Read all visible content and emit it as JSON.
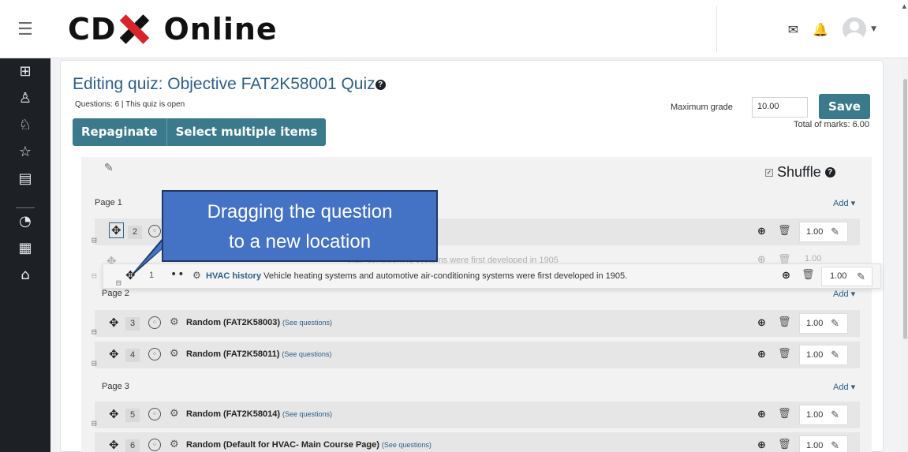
{
  "topbar": {
    "logo_text": "Online",
    "brand_colors": {
      "black": "#111111",
      "red": "#d9252a"
    },
    "icons": [
      "menu-icon",
      "mail-icon",
      "bell-icon",
      "user-avatar",
      "caret-down-icon"
    ]
  },
  "sidebar": {
    "items": [
      {
        "icon": "dashboard-icon"
      },
      {
        "icon": "participants-icon"
      },
      {
        "icon": "badges-icon"
      },
      {
        "icon": "star-icon"
      },
      {
        "icon": "grades-icon"
      },
      {
        "icon": "dashboard-gauge-icon"
      },
      {
        "icon": "calendar-icon"
      },
      {
        "icon": "graduation-cap-icon"
      }
    ]
  },
  "header": {
    "title": "Editing quiz: Objective FAT2K58001 Quiz",
    "subtitle": "Questions: 6 | This quiz is open",
    "max_grade_label": "Maximum grade",
    "max_grade_value": "10.00",
    "save_label": "Save",
    "total_marks": "Total of marks: 6.00",
    "repaginate_label": "Repaginate",
    "select_multiple_label": "Select multiple items"
  },
  "section": {
    "shuffle_label": "Shuffle",
    "shuffle_checked": true
  },
  "pages": [
    {
      "label": "Page 1",
      "add_label": "Add"
    },
    {
      "label": "Page 2",
      "add_label": "Add"
    },
    {
      "label": "Page 3",
      "add_label": "Add"
    }
  ],
  "questions": [
    {
      "num": "2",
      "title": "",
      "mark": "1.00"
    },
    {
      "num": "3",
      "title": "Random (FAT2K58003)",
      "link": "(See questions)",
      "mark": "1.00"
    },
    {
      "num": "4",
      "title": "Random (FAT2K58011)",
      "link": "(See questions)",
      "mark": "1.00"
    },
    {
      "num": "5",
      "title": "Random (FAT2K58014)",
      "link": "(See questions)",
      "mark": "1.00"
    },
    {
      "num": "6",
      "title": "Random (Default for HVAC- Main Course Page)",
      "link": "(See questions)",
      "mark": "1.00"
    }
  ],
  "dragged": {
    "num": "1",
    "name": "HVAC history",
    "text": "Vehicle heating systems and automotive air-conditioning systems were first developed in 1905.",
    "mark": "1.00"
  },
  "ghost": {
    "text": "...air-conditioning systems were first developed in 1905",
    "mark": "1.00"
  },
  "callout": {
    "line1": "Dragging the question",
    "line2": "to a new location",
    "fill": "#4472c4",
    "border": "#1f3864"
  },
  "colors": {
    "accent": "#3b7a8c",
    "title": "#2b5f8a",
    "sidebar": "#1d2125"
  }
}
